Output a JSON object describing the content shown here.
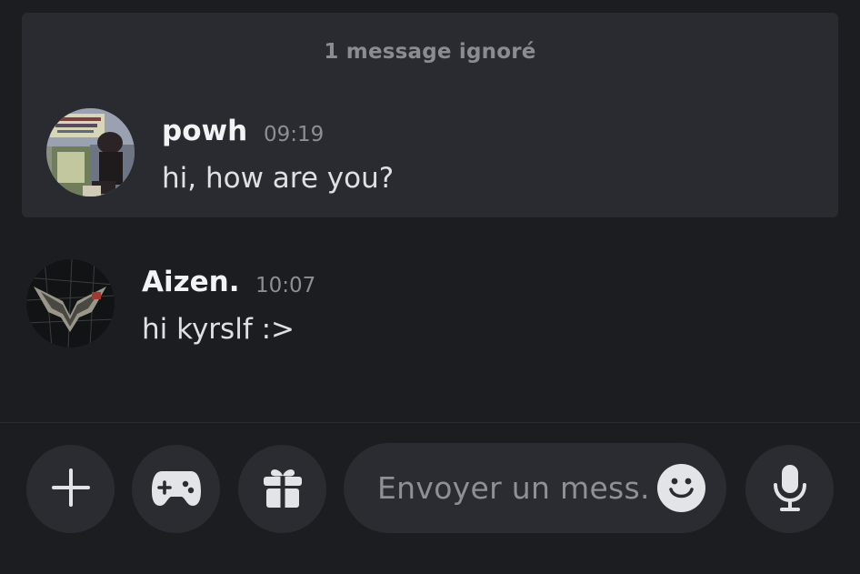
{
  "ignored_block": {
    "header": "1 message ignoré"
  },
  "messages": [
    {
      "author": "powh",
      "time": "09:19",
      "text": "hi, how are you?",
      "avatar": "album-cover-avatar"
    },
    {
      "author": "Aizen.",
      "time": "10:07",
      "text": "hi kyrslf :>",
      "avatar": "dark-logo-avatar"
    }
  ],
  "composer": {
    "placeholder": "Envoyer un mess..",
    "buttons": [
      "plus-icon",
      "gamepad-icon",
      "gift-icon",
      "microphone-icon"
    ],
    "emoji": "smiley-icon"
  },
  "colors": {
    "background": "#1c1d21",
    "ignored_background": "#2a2b30",
    "control_background": "#2b2c31"
  }
}
